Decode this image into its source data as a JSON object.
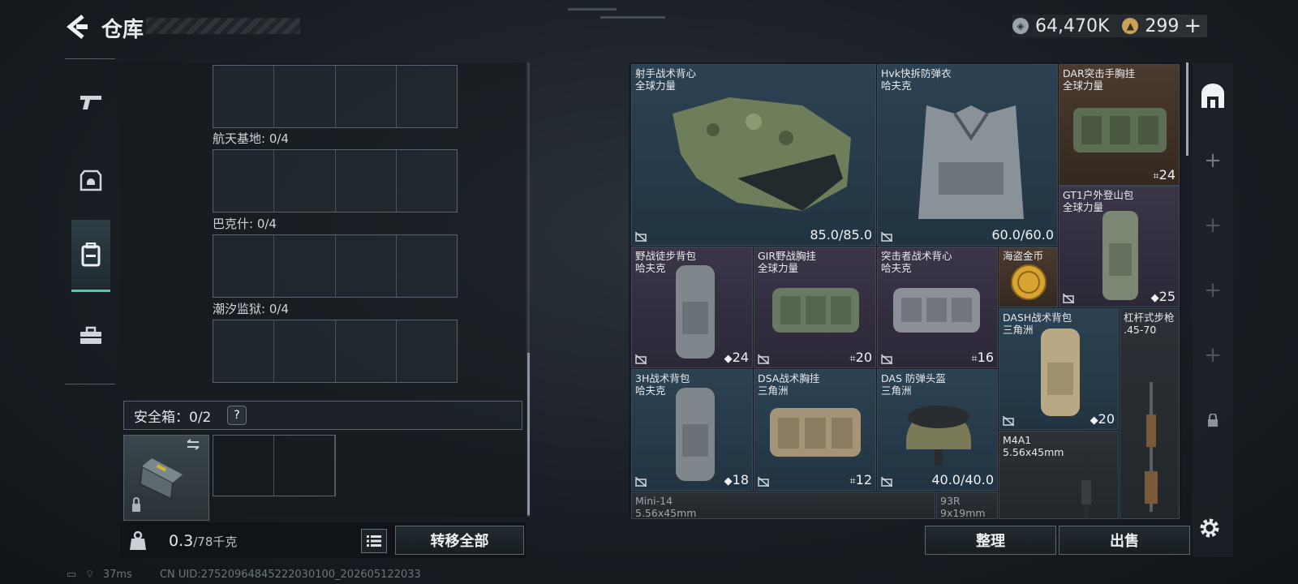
{
  "header": {
    "title": "仓库"
  },
  "currency": [
    {
      "icon": "silver-coin-icon",
      "value": "64,470K"
    },
    {
      "icon": "gold-coin-icon",
      "value": "299"
    }
  ],
  "header_plus": "+",
  "sidebar": {
    "tabs": [
      {
        "icon": "pistol-icon"
      },
      {
        "icon": "armor-helmet-icon"
      },
      {
        "icon": "backpack-icon"
      },
      {
        "icon": "toolbox-icon"
      }
    ]
  },
  "stash": {
    "maps": [
      {
        "label": "航天基地: 0/4"
      },
      {
        "label": "巴克什: 0/4"
      },
      {
        "label": "潮汐监狱: 0/4"
      }
    ],
    "safe_label": "安全箱：0/2",
    "safe_help": "?",
    "weight_value": "0.3",
    "weight_capacity": "/78千克",
    "transfer_all": "转移全部"
  },
  "items": [
    {
      "name": "射手战术背心",
      "sub": "全球力量",
      "stat": "85.0/85.0"
    },
    {
      "name": "Hvk快拆防弹衣",
      "sub": "哈夫克",
      "stat": "60.0/60.0"
    },
    {
      "name": "DAR突击手胸挂",
      "sub": "全球力量",
      "stat": "24"
    },
    {
      "name": "GT1户外登山包",
      "sub": "全球力量",
      "stat": "25"
    },
    {
      "name": "野战徒步背包",
      "sub": "哈夫克",
      "stat": "24"
    },
    {
      "name": "GIR野战胸挂",
      "sub": "全球力量",
      "stat": "20"
    },
    {
      "name": "突击者战术背心",
      "sub": "哈夫克",
      "stat": "16"
    },
    {
      "name": "海盗金币",
      "sub": "",
      "stat": ""
    },
    {
      "name": "DASH战术背包",
      "sub": "三角洲",
      "stat": "20"
    },
    {
      "name": "杠杆式步枪",
      "sub": ".45-70",
      "stat": ""
    },
    {
      "name": "3H战术背包",
      "sub": "哈夫克",
      "stat": "18"
    },
    {
      "name": "DSA战术胸挂",
      "sub": "三角洲",
      "stat": "12"
    },
    {
      "name": "DAS 防弹头盔",
      "sub": "三角洲",
      "stat": "40.0/40.0"
    },
    {
      "name": "M4A1",
      "sub": "5.56x45mm",
      "stat": ""
    },
    {
      "name": "Mini-14",
      "sub": "5.56x45mm",
      "stat": ""
    },
    {
      "name": "93R",
      "sub": "9x19mm",
      "stat": ""
    }
  ],
  "actions": {
    "sort": "整理",
    "sell": "出售"
  },
  "right_side": [
    "+",
    "+",
    "+",
    "+"
  ],
  "status": {
    "ping": "37ms",
    "uid": "CN UID:27520964845222030100_202605122033"
  }
}
